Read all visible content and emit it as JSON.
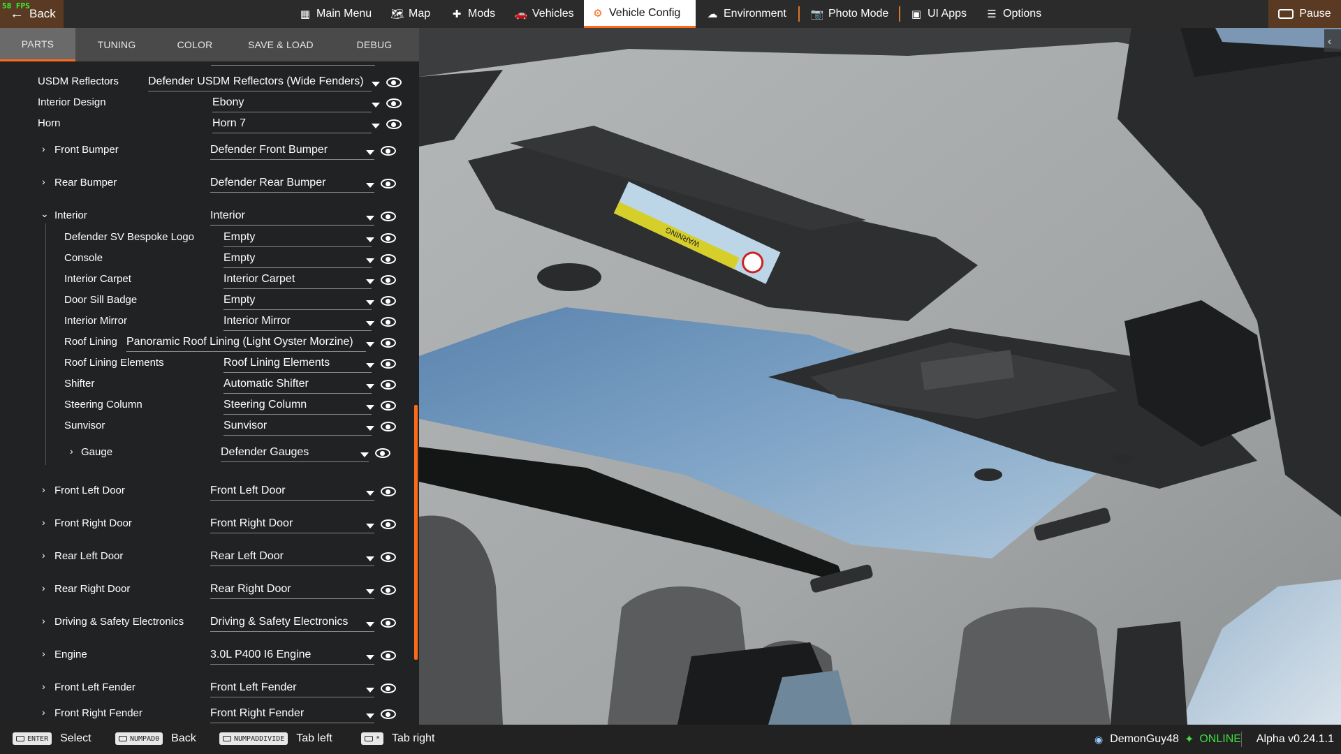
{
  "fps": "58 FPS",
  "topbar": {
    "back_label": "Back",
    "items": [
      {
        "label": "Main Menu",
        "icon": "grid-icon"
      },
      {
        "label": "Map",
        "icon": "map-icon"
      },
      {
        "label": "Mods",
        "icon": "puzzle-icon"
      },
      {
        "label": "Vehicles",
        "icon": "car-icon"
      },
      {
        "label": "Vehicle Config",
        "icon": "engine-icon",
        "active": true
      },
      {
        "label": "Environment",
        "icon": "weather-icon"
      },
      {
        "label": "Photo Mode",
        "icon": "camera-icon"
      },
      {
        "label": "UI Apps",
        "icon": "apps-icon"
      },
      {
        "label": "Options",
        "icon": "sliders-icon"
      }
    ],
    "pause_label": "Pause"
  },
  "panel": {
    "tabs": [
      "PARTS",
      "TUNING",
      "COLOR",
      "SAVE & LOAD",
      "DEBUG"
    ],
    "active_tab": "PARTS",
    "rows": [
      {
        "label": "USDM Reflectors",
        "value": "Defender USDM Reflectors (Wide Fenders)"
      },
      {
        "label": "Interior Design",
        "value": "Ebony"
      },
      {
        "label": "Horn",
        "value": "Horn 7"
      },
      {
        "label": "Front Bumper",
        "value": "Defender Front Bumper"
      },
      {
        "label": "Rear Bumper",
        "value": "Defender Rear Bumper"
      },
      {
        "label": "Interior",
        "value": "Interior"
      },
      {
        "label": "Defender SV Bespoke Logo",
        "value": "Empty"
      },
      {
        "label": "Console",
        "value": "Empty"
      },
      {
        "label": "Interior Carpet",
        "value": "Interior Carpet"
      },
      {
        "label": "Door Sill Badge",
        "value": "Empty"
      },
      {
        "label": "Interior Mirror",
        "value": "Interior Mirror"
      },
      {
        "label": "Roof Lining",
        "value": "Panoramic Roof Lining (Light Oyster Morzine)"
      },
      {
        "label": "Roof Lining Elements",
        "value": "Roof Lining Elements"
      },
      {
        "label": "Shifter",
        "value": "Automatic Shifter"
      },
      {
        "label": "Steering Column",
        "value": "Steering Column"
      },
      {
        "label": "Sunvisor",
        "value": "Sunvisor"
      },
      {
        "label": "Gauge",
        "value": "Defender Gauges"
      },
      {
        "label": "Front Left Door",
        "value": "Front Left Door"
      },
      {
        "label": "Front Right Door",
        "value": "Front Right Door"
      },
      {
        "label": "Rear Left Door",
        "value": "Rear Left Door"
      },
      {
        "label": "Rear Right Door",
        "value": "Rear Right Door"
      },
      {
        "label": "Driving & Safety Electronics",
        "value": "Driving & Safety Electronics"
      },
      {
        "label": "Engine",
        "value": "3.0L P400 I6 Engine"
      },
      {
        "label": "Front Left Fender",
        "value": "Front Left Fender"
      },
      {
        "label": "Front Right Fender",
        "value": "Front Right Fender"
      }
    ]
  },
  "bottombar": {
    "hints": [
      {
        "key": "ENTER",
        "label": "Select"
      },
      {
        "key": "NUMPAD0",
        "label": "Back"
      },
      {
        "key": "NUMPADDIVIDE",
        "label": "Tab left"
      },
      {
        "key": "*",
        "label": "Tab right"
      }
    ],
    "username": "DemonGuy48",
    "status": "ONLINE",
    "version": "Alpha v0.24.1.1"
  },
  "scene": {
    "sticker_text": "WARNING"
  },
  "colors": {
    "accent": "#ff6a1a",
    "online": "#3fe03f"
  }
}
